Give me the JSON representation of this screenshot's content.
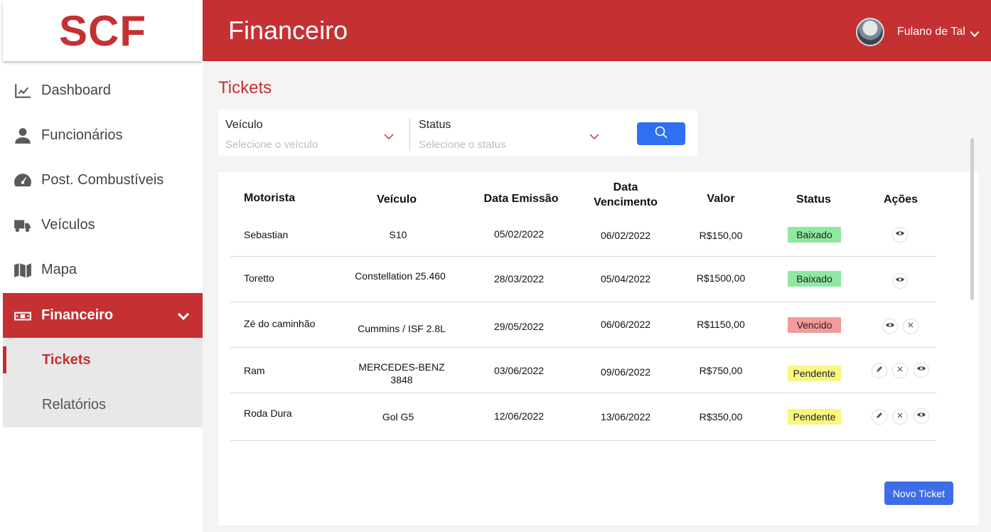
{
  "brand": {
    "logo_text": "SCF",
    "accent": "#c53033"
  },
  "header": {
    "title": "Financeiro",
    "user_name": "Fulano de Tal"
  },
  "sidebar": {
    "items": [
      {
        "label": "Dashboard",
        "icon": "chart-line-icon"
      },
      {
        "label": "Funcionários",
        "icon": "user-icon"
      },
      {
        "label": "Post. Combustíveis",
        "icon": "gauge-icon"
      },
      {
        "label": "Veículos",
        "icon": "truck-icon"
      },
      {
        "label": "Mapa",
        "icon": "map-icon"
      },
      {
        "label": "Financeiro",
        "icon": "money-icon",
        "active": true
      }
    ],
    "submenu": [
      {
        "label": "Tickets",
        "current": true
      },
      {
        "label": "Relatórios"
      }
    ]
  },
  "main": {
    "page_title": "Tickets",
    "filters": {
      "vehicle": {
        "label": "Veículo",
        "placeholder": "Selecione o veículo"
      },
      "status": {
        "label": "Status",
        "placeholder": "Selecione o status"
      }
    },
    "table": {
      "headers": [
        "Motorista",
        "Veículo",
        "Data Emissão",
        "Data\nVencimento",
        "Valor",
        "Status",
        "Ações"
      ],
      "rows": [
        {
          "motorista": "Sebastian",
          "veiculo": "S10",
          "emissao": "05/02/2022",
          "vencimento": "06/02/2022",
          "valor": "R$150,00",
          "status": "Baixado",
          "actions": [
            "view"
          ]
        },
        {
          "motorista": "Toretto",
          "veiculo": "Constellation 25.460",
          "emissao": "28/03/2022",
          "vencimento": "05/04/2022",
          "valor": "R$1500,00",
          "status": "Baixado",
          "actions": [
            "view"
          ]
        },
        {
          "motorista": "Zé do caminhão",
          "veiculo": "Cummins / ISF 2.8L",
          "emissao": "29/05/2022",
          "vencimento": "06/06/2022",
          "valor": "R$1150,00",
          "status": "Vencido",
          "actions": [
            "view",
            "cancel"
          ]
        },
        {
          "motorista": "Ram",
          "veiculo": "MERCEDES-BENZ\n3848",
          "emissao": "03/06/2022",
          "vencimento": "09/06/2022",
          "valor": "R$750,00",
          "status": "Pendente",
          "actions": [
            "edit",
            "cancel",
            "view"
          ]
        },
        {
          "motorista": "Roda Dura",
          "veiculo": "Gol G5",
          "emissao": "12/06/2022",
          "vencimento": "13/06/2022",
          "valor": "R$350,00",
          "status": "Pendente",
          "actions": [
            "edit",
            "cancel",
            "view"
          ]
        }
      ]
    },
    "new_ticket_label": "Novo Ticket"
  },
  "status_colors": {
    "Baixado": "#8fe8a0",
    "Vencido": "#f39a9a",
    "Pendente": "#f9f77f"
  }
}
